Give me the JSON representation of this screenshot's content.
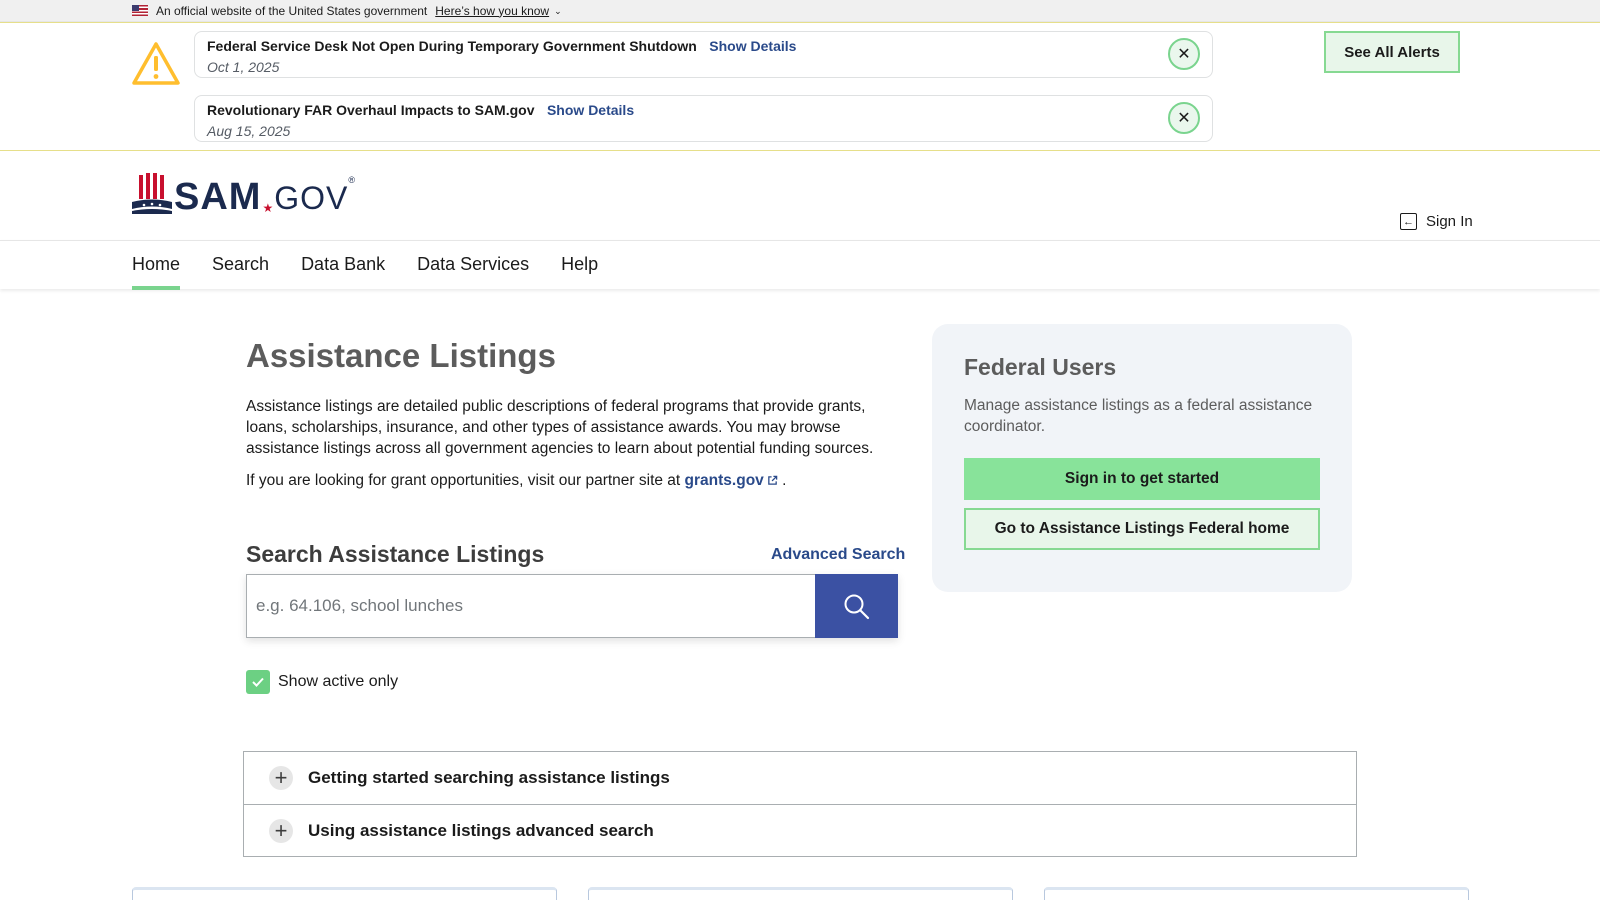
{
  "gov_banner": {
    "text": "An official website of the United States government",
    "link": "Here’s how you know"
  },
  "alerts": {
    "items": [
      {
        "title": "Federal Service Desk Not Open During Temporary Government Shutdown",
        "action": "Show Details",
        "date": "Oct 1, 2025"
      },
      {
        "title": "Revolutionary FAR Overhaul Impacts to SAM.gov",
        "action": "Show Details",
        "date": "Aug 15, 2025"
      }
    ],
    "see_all": "See All Alerts"
  },
  "header": {
    "logo_sam": "SAM",
    "logo_gov": "GOV",
    "logo_reg": "®",
    "sign_in": "Sign In"
  },
  "nav": {
    "items": [
      "Home",
      "Search",
      "Data Bank",
      "Data Services",
      "Help"
    ],
    "active": "Home"
  },
  "main": {
    "title": "Assistance Listings",
    "description": "Assistance listings are detailed public descriptions of federal programs that provide grants, loans, scholarships, insurance, and other types of assistance awards. You may browse assistance listings across all government agencies to learn about potential funding sources.",
    "partner_prefix": "If you are looking for grant opportunities, visit our partner site at",
    "partner_link": "grants.gov",
    "partner_suffix": ".",
    "search_heading": "Search Assistance Listings",
    "advanced_search": "Advanced Search",
    "search_placeholder": "e.g. 64.106, school lunches",
    "search_value": "",
    "active_only_label": "Show active only",
    "active_only_checked": true
  },
  "federal_users": {
    "title": "Federal Users",
    "description": "Manage assistance listings as a federal assistance coordinator.",
    "primary_button": "Sign in to get started",
    "secondary_button": "Go to Assistance Listings Federal home"
  },
  "accordion": {
    "items": [
      "Getting started searching assistance listings",
      "Using assistance listings advanced search"
    ]
  },
  "colors": {
    "accent_green": "#7ad48e",
    "link_blue": "#2a4a8a",
    "search_button": "#3b51a3",
    "brand_navy": "#1b2a4e",
    "brand_red": "#c8102e"
  },
  "icons": [
    "us-flag-icon",
    "warning-icon",
    "close-icon",
    "sign-in-icon",
    "search-icon",
    "external-link-icon",
    "checkmark-icon",
    "plus-icon"
  ]
}
